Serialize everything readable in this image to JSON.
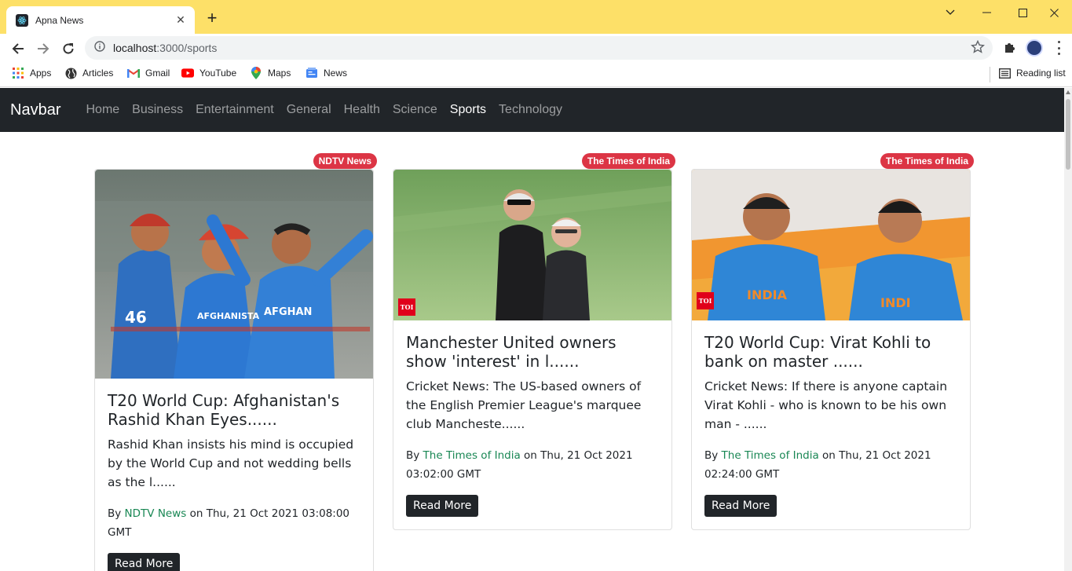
{
  "browser": {
    "tab_title": "Apna News",
    "url_host": "localhost",
    "url_rest": ":3000/sports",
    "bookmarks": [
      {
        "label": "Apps",
        "icon": "apps-grid-icon"
      },
      {
        "label": "Articles",
        "icon": "globe-icon"
      },
      {
        "label": "Gmail",
        "icon": "gmail-icon"
      },
      {
        "label": "YouTube",
        "icon": "youtube-icon"
      },
      {
        "label": "Maps",
        "icon": "maps-pin-icon"
      },
      {
        "label": "News",
        "icon": "news-icon"
      }
    ],
    "reading_list": "Reading list",
    "accent": "#fde068"
  },
  "navbar": {
    "brand": "Navbar",
    "links": [
      "Home",
      "Business",
      "Entertainment",
      "General",
      "Health",
      "Science",
      "Sports",
      "Technology"
    ],
    "active": "Sports"
  },
  "articles": [
    {
      "badge": "NDTV News",
      "title": "T20 World Cup: Afghanistan's Rashid Khan Eyes......",
      "description": "Rashid Khan insists his mind is occupied by the World Cup and not wedding bells as the l......",
      "by": "By ",
      "source": "NDTV News",
      "on": " on Thu, 21 Oct 2021 03:08:00 GMT",
      "button": "Read More"
    },
    {
      "badge": "The Times of India",
      "title": "Manchester United owners show 'interest' in l......",
      "description": "Cricket News: The US-based owners of the English Premier League's marquee club Mancheste......",
      "by": "By ",
      "source": "The Times of India",
      "on": " on Thu, 21 Oct 2021 03:02:00 GMT",
      "button": "Read More",
      "logo": "TOI"
    },
    {
      "badge": "The Times of India",
      "title": "T20 World Cup: Virat Kohli to bank on master ......",
      "description": "Cricket News: If there is anyone captain Virat Kohli - who is known to be his own man - ......",
      "by": "By ",
      "source": "The Times of India",
      "on": " on Thu, 21 Oct 2021 02:24:00 GMT",
      "button": "Read More",
      "logo": "TOI"
    }
  ]
}
